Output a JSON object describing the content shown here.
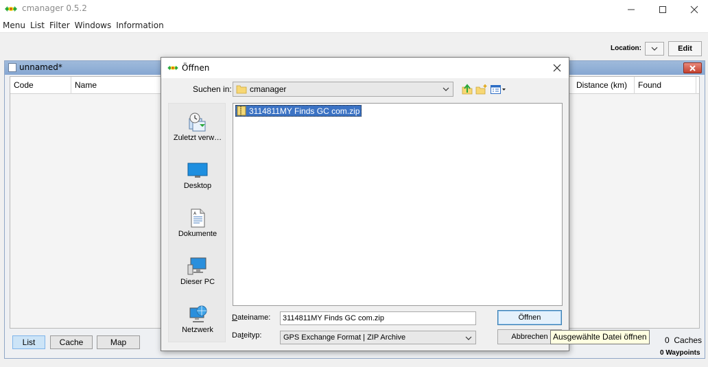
{
  "window": {
    "title": "cmanager 0.5.2"
  },
  "menu": [
    {
      "label": "Menu"
    },
    {
      "label": "List"
    },
    {
      "label": "Filter"
    },
    {
      "label": "Windows"
    },
    {
      "label": "Information"
    }
  ],
  "toolbar": {
    "location_label": "Location:",
    "edit_label": "Edit"
  },
  "list_frame": {
    "title": "unnamed*",
    "columns": [
      "Code",
      "Name",
      "Distance (km)",
      "Found"
    ],
    "view_buttons": [
      "List",
      "Cache",
      "Map"
    ],
    "selected_view": "List",
    "caches_count": "0",
    "caches_label": "Caches",
    "waypoints_label": "0 Waypoints"
  },
  "dialog": {
    "title": "Öffnen",
    "look_in_label": "Suchen in:",
    "look_in_value": "cmanager",
    "places": [
      {
        "label": "Zuletzt verw…",
        "icon": "recent-items-icon"
      },
      {
        "label": "Desktop",
        "icon": "desktop-icon"
      },
      {
        "label": "Dokumente",
        "icon": "documents-icon"
      },
      {
        "label": "Dieser PC",
        "icon": "computer-icon"
      },
      {
        "label": "Netzwerk",
        "icon": "network-icon"
      }
    ],
    "files": [
      {
        "name": "3114811MY Finds GC com.zip",
        "selected": true
      }
    ],
    "filename_label": "Dateiname:",
    "filename_value": "3114811MY Finds GC com.zip",
    "filetype_label": "Dateityp:",
    "filetype_value": "GPS Exchange Format | ZIP Archive",
    "open_label": "Öffnen",
    "cancel_label": "Abbrechen",
    "tooltip": "Ausgewählte Datei öffnen"
  },
  "colors": {
    "selection": "#3c73c4",
    "tooltip_bg": "#ffffe1",
    "frame_title": "#9fbadb"
  }
}
